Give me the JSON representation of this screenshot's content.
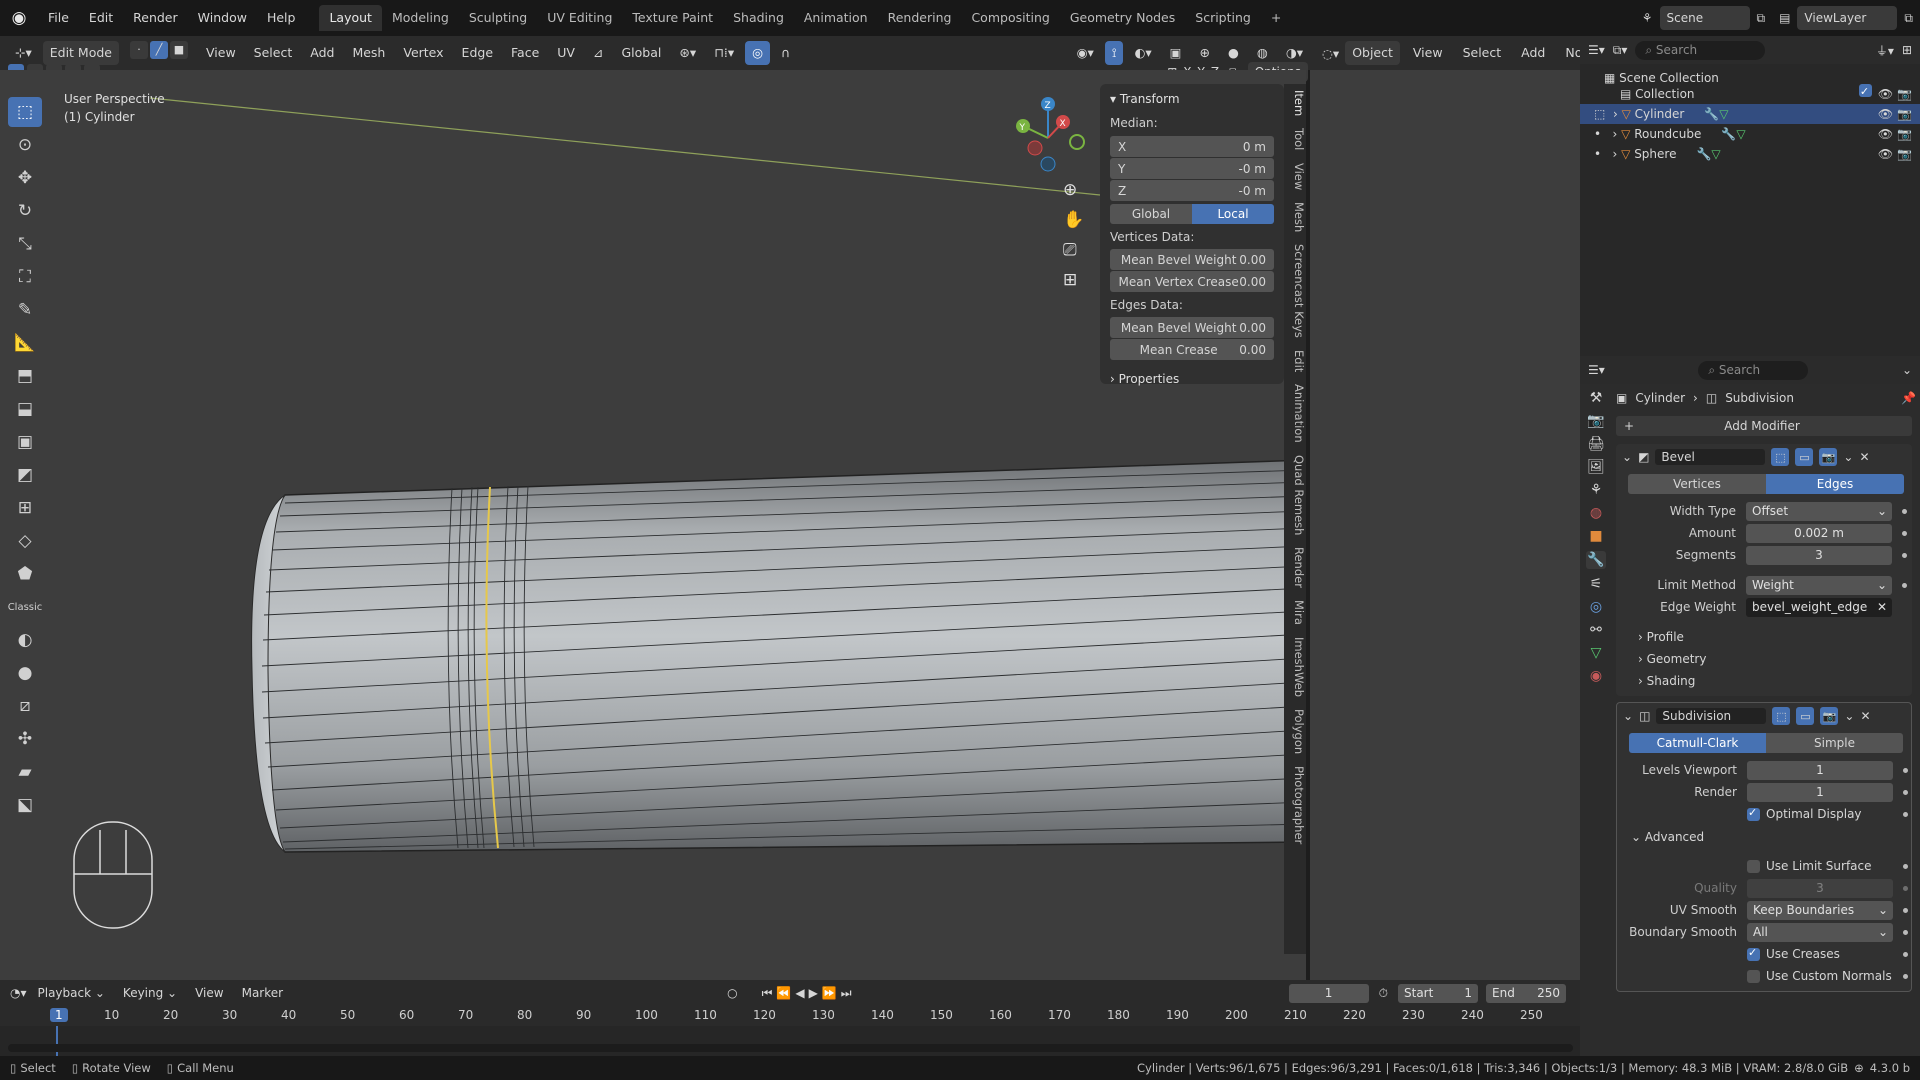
{
  "topbar": {
    "menus": [
      "File",
      "Edit",
      "Render",
      "Window",
      "Help"
    ],
    "workspaces": [
      "Layout",
      "Modeling",
      "Sculpting",
      "UV Editing",
      "Texture Paint",
      "Shading",
      "Animation",
      "Rendering",
      "Compositing",
      "Geometry Nodes",
      "Scripting"
    ],
    "active_workspace": "Layout",
    "scene": "Scene",
    "view_layer": "ViewLayer"
  },
  "header": {
    "mode": "Edit Mode",
    "menus": [
      "View",
      "Select",
      "Add",
      "Mesh",
      "Vertex",
      "Edge",
      "Face",
      "UV"
    ],
    "orientation": "Global",
    "object_menus": [
      "Object",
      "View",
      "Select",
      "Add",
      "No"
    ],
    "options_label": "Options",
    "axes": [
      "X",
      "Y",
      "Z"
    ]
  },
  "viewport": {
    "perspective": "User Perspective",
    "object": "(1) Cylinder",
    "gizmo": {
      "z": "Z",
      "y": "Y",
      "x": "X"
    }
  },
  "npanel": {
    "transform_title": "Transform",
    "median_label": "Median:",
    "x": {
      "label": "X",
      "value": "0 m"
    },
    "y": {
      "label": "Y",
      "value": "-0 m"
    },
    "z": {
      "label": "Z",
      "value": "-0 m"
    },
    "global": "Global",
    "local": "Local",
    "vertices_data": "Vertices Data:",
    "mean_bevel_weight_v": {
      "label": "Mean Bevel Weight",
      "value": "0.00"
    },
    "mean_vertex_crease": {
      "label": "Mean Vertex Crease",
      "value": "0.00"
    },
    "edges_data": "Edges Data:",
    "mean_bevel_weight_e": {
      "label": "Mean Bevel Weight",
      "value": "0.00"
    },
    "mean_crease": {
      "label": "Mean Crease",
      "value": "0.00"
    },
    "properties": "Properties"
  },
  "vtabs": [
    "Item",
    "Tool",
    "View",
    "Mesh",
    "Screencast Keys",
    "Edit",
    "Animation",
    "Quad Remesh",
    "Render",
    "Mira",
    "ImeshWeb",
    "Polygon",
    "Photographer"
  ],
  "outliner": {
    "search_placeholder": "Search",
    "scene_collection": "Scene Collection",
    "collection": "Collection",
    "objects": [
      "Cylinder",
      "Roundcube",
      "Sphere"
    ]
  },
  "properties": {
    "search_placeholder": "Search",
    "breadcrumb_object": "Cylinder",
    "breadcrumb_modifier": "Subdivision",
    "add_modifier": "Add Modifier",
    "bevel": {
      "name": "Bevel",
      "vertices": "Vertices",
      "edges": "Edges",
      "width_type": {
        "label": "Width Type",
        "value": "Offset"
      },
      "amount": {
        "label": "Amount",
        "value": "0.002 m"
      },
      "segments": {
        "label": "Segments",
        "value": "3"
      },
      "limit_method": {
        "label": "Limit Method",
        "value": "Weight"
      },
      "edge_weight": {
        "label": "Edge Weight",
        "value": "bevel_weight_edge"
      },
      "profile": "Profile",
      "geometry": "Geometry",
      "shading": "Shading"
    },
    "subdivision": {
      "name": "Subdivision",
      "catmull": "Catmull-Clark",
      "simple": "Simple",
      "levels_viewport": {
        "label": "Levels Viewport",
        "value": "1"
      },
      "render": {
        "label": "Render",
        "value": "1"
      },
      "optimal_display": "Optimal Display",
      "advanced": "Advanced",
      "use_limit_surface": "Use Limit Surface",
      "quality": {
        "label": "Quality",
        "value": "3"
      },
      "uv_smooth": {
        "label": "UV Smooth",
        "value": "Keep Boundaries"
      },
      "boundary_smooth": {
        "label": "Boundary Smooth",
        "value": "All"
      },
      "use_creases": "Use Creases",
      "use_custom_normals": "Use Custom Normals"
    }
  },
  "timeline": {
    "menus": [
      "Playback",
      "Keying",
      "View",
      "Marker"
    ],
    "current_frame": "1",
    "start_label": "Start",
    "start": "1",
    "end_label": "End",
    "end": "250",
    "ticks": [
      "1",
      "10",
      "20",
      "30",
      "40",
      "50",
      "60",
      "70",
      "80",
      "90",
      "100",
      "110",
      "120",
      "130",
      "140",
      "150",
      "160",
      "170",
      "180",
      "190",
      "200",
      "210",
      "220",
      "230",
      "240",
      "250"
    ]
  },
  "status": {
    "select": "Select",
    "rotate": "Rotate View",
    "call_menu": "Call Menu",
    "stats": "Cylinder | Verts:96/1,675 | Edges:96/3,291 | Faces:0/1,618 | Tris:3,346 | Objects:1/3 | Memory: 48.3 MiB | VRAM: 2.8/8.0 GiB",
    "version": "4.3.0 b"
  }
}
